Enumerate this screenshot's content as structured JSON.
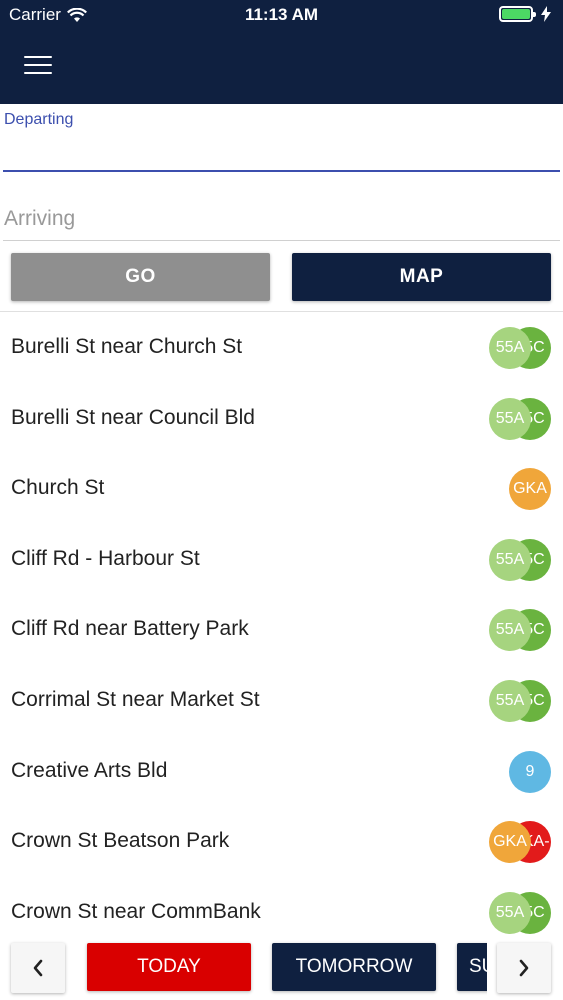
{
  "status_bar": {
    "carrier": "Carrier",
    "time": "11:13 AM"
  },
  "search": {
    "departing_label": "Departing",
    "departing_value": "",
    "arriving_placeholder": "Arriving"
  },
  "buttons": {
    "go": "GO",
    "map": "MAP"
  },
  "stops": [
    {
      "name": "Burelli St near Church St",
      "routes": [
        {
          "label": "55A",
          "color": "#a6d47f"
        },
        {
          "label": "55C",
          "color": "#6ab33f"
        }
      ]
    },
    {
      "name": "Burelli St near Council Bld",
      "routes": [
        {
          "label": "55A",
          "color": "#a6d47f"
        },
        {
          "label": "55C",
          "color": "#6ab33f"
        }
      ]
    },
    {
      "name": "Church St",
      "routes": [
        {
          "label": "GKA",
          "color": "#f0a63a"
        }
      ]
    },
    {
      "name": "Cliff Rd - Harbour St",
      "routes": [
        {
          "label": "55A",
          "color": "#a6d47f"
        },
        {
          "label": "55C",
          "color": "#6ab33f"
        }
      ]
    },
    {
      "name": "Cliff Rd near Battery Park",
      "routes": [
        {
          "label": "55A",
          "color": "#a6d47f"
        },
        {
          "label": "55C",
          "color": "#6ab33f"
        }
      ]
    },
    {
      "name": "Corrimal St near Market St",
      "routes": [
        {
          "label": "55A",
          "color": "#a6d47f"
        },
        {
          "label": "55C",
          "color": "#6ab33f"
        }
      ]
    },
    {
      "name": "Creative Arts Bld",
      "routes": [
        {
          "label": "9",
          "color": "#5fb8e3"
        }
      ]
    },
    {
      "name": "Crown St Beatson Park",
      "routes": [
        {
          "label": "GKA",
          "color": "#f0a63a"
        },
        {
          "label": "GKA-",
          "color": "#e21b1b"
        }
      ]
    },
    {
      "name": "Crown St near CommBank",
      "routes": [
        {
          "label": "55A",
          "color": "#a6d47f"
        },
        {
          "label": "55C",
          "color": "#6ab33f"
        }
      ]
    }
  ],
  "days": [
    {
      "label": "TODAY",
      "color": "#d90000"
    },
    {
      "label": "TOMORROW",
      "color": "#0f2040"
    },
    {
      "label": "SU",
      "color": "#0f2040"
    }
  ],
  "colors": {
    "navy": "#0f2040",
    "accent": "#3c4fae",
    "go_gray": "#8f8f8f"
  }
}
